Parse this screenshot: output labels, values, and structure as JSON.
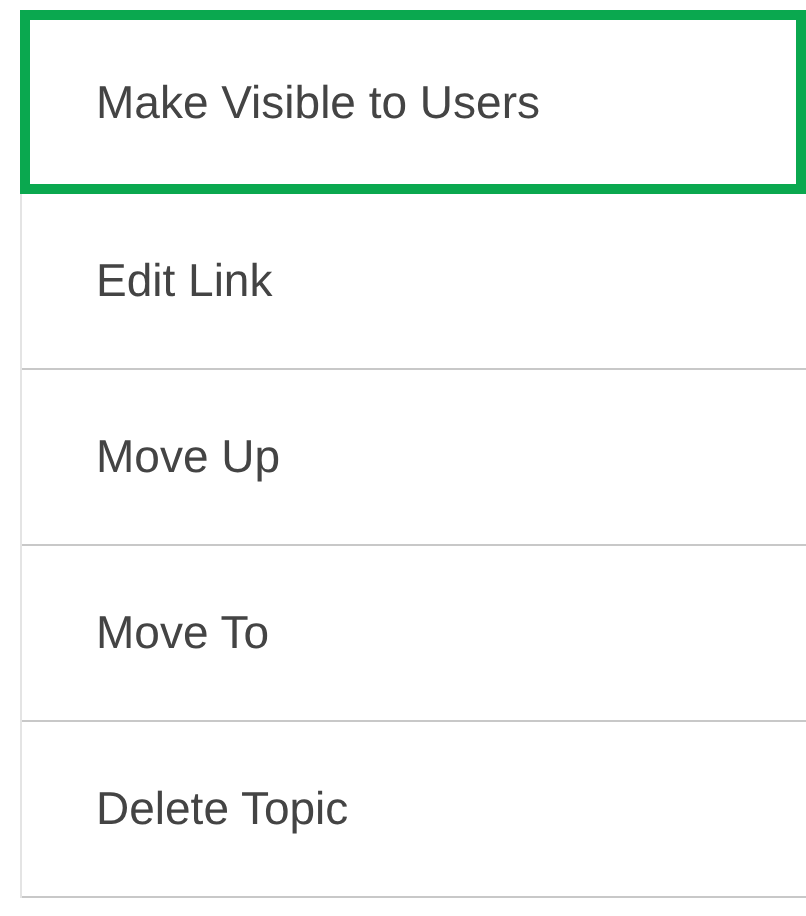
{
  "menu": {
    "items": [
      {
        "label": "Make Visible to Users",
        "selected": true
      },
      {
        "label": "Edit Link",
        "selected": false
      },
      {
        "label": "Move Up",
        "selected": false
      },
      {
        "label": "Move To",
        "selected": false
      },
      {
        "label": "Delete Topic",
        "selected": false
      }
    ]
  }
}
